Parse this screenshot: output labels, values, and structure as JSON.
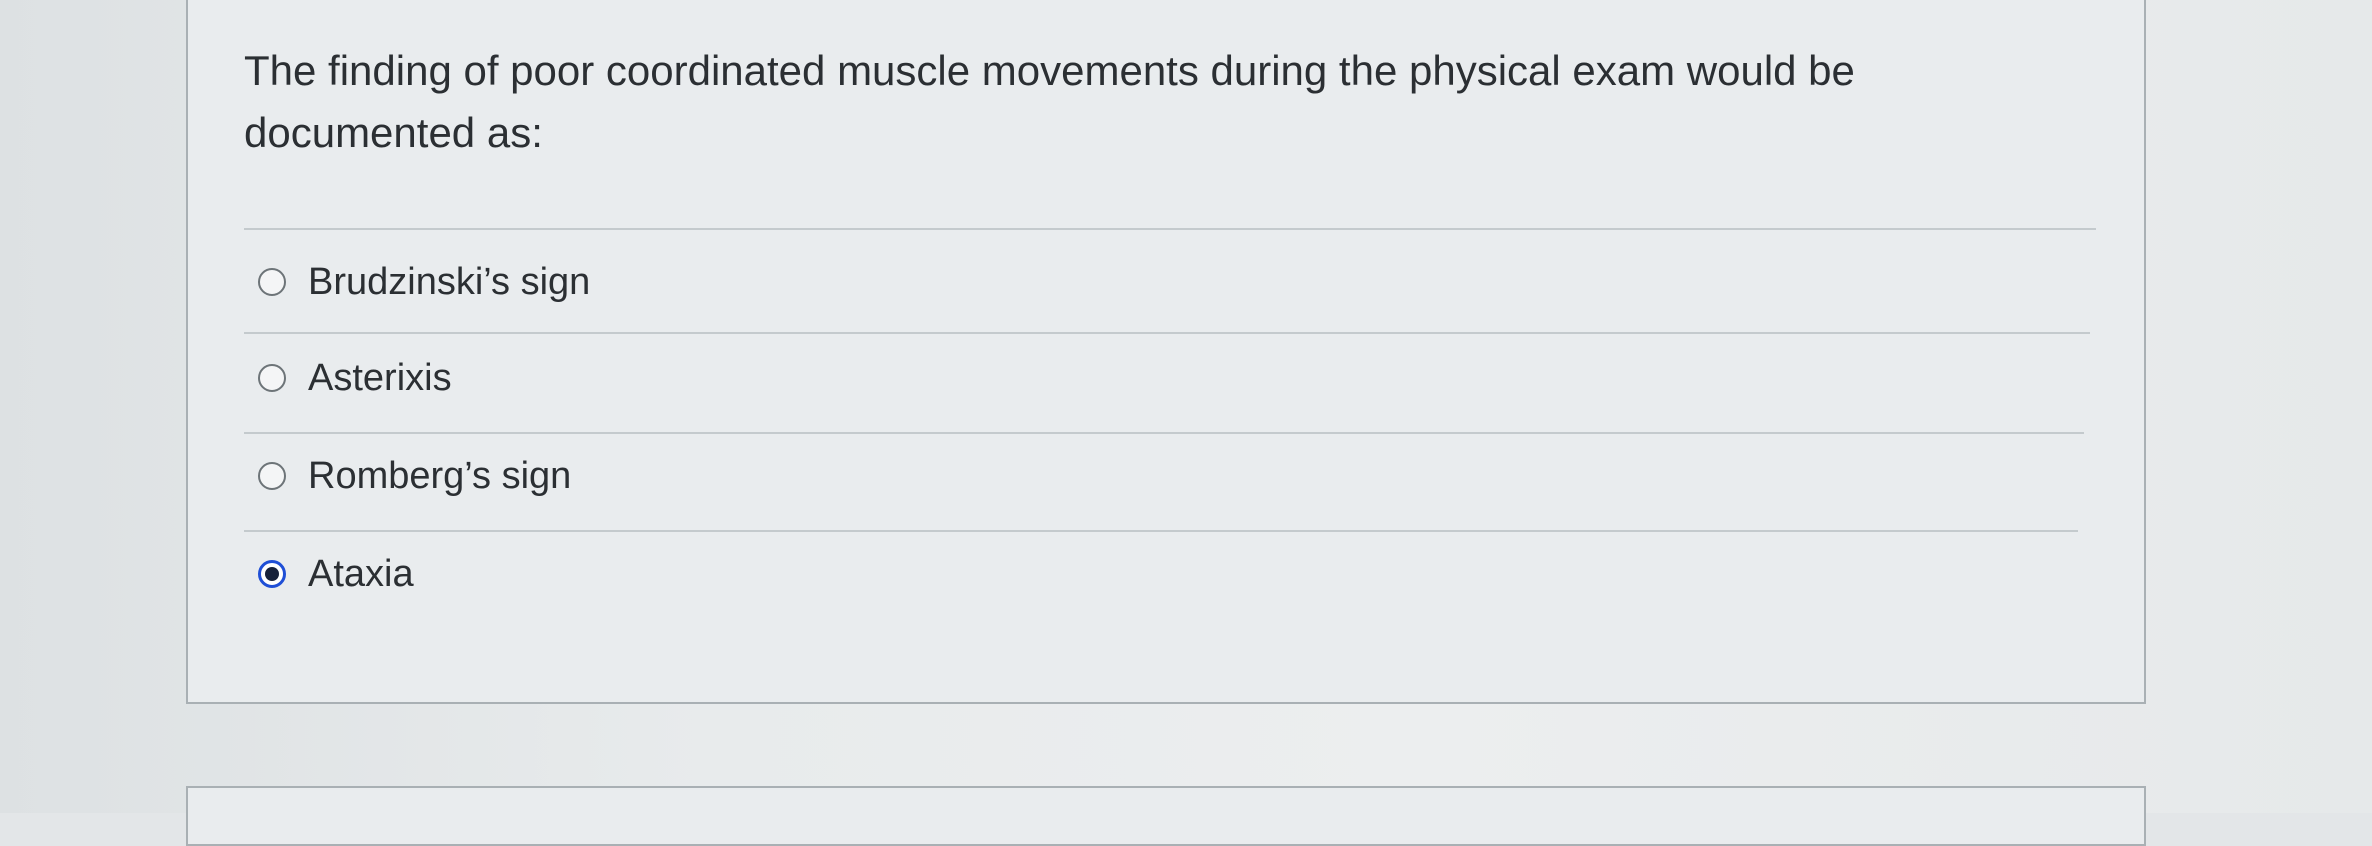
{
  "question": {
    "text": "The finding of poor coordinated muscle movements during the physical exam would be documented as:"
  },
  "options": [
    {
      "label": "Brudzinski’s sign",
      "selected": false
    },
    {
      "label": "Asterixis",
      "selected": false
    },
    {
      "label": "Romberg’s sign",
      "selected": false
    },
    {
      "label": "Ataxia",
      "selected": true
    }
  ],
  "colors": {
    "radio_selected": "#1f4fd6",
    "text": "#2b2f33",
    "card_border": "#a9b0b4"
  }
}
